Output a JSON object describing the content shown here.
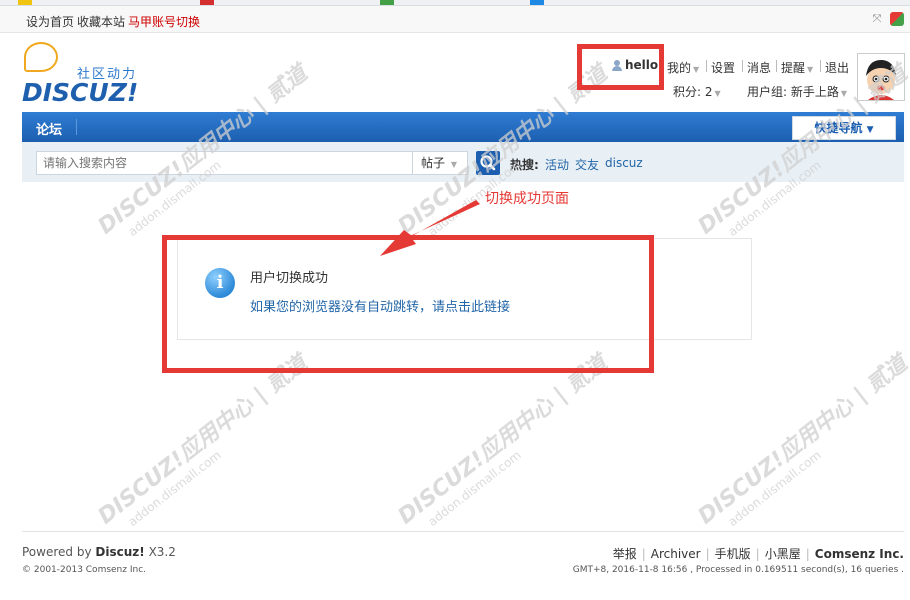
{
  "topbar": {
    "set_home": "设为首页",
    "bookmark": "收藏本站",
    "switch_account": "马甲账号切换"
  },
  "logo": {
    "slogan": "社区动力",
    "wordmark": "DISCUZ!"
  },
  "user": {
    "name": "hello",
    "menu_mine": "我的",
    "menu_settings": "设置",
    "menu_messages": "消息",
    "menu_reminders": "提醒",
    "menu_logout": "退出",
    "credits": "积分: 2",
    "group": "用户组: 新手上路"
  },
  "nav": {
    "forum": "论坛",
    "quick_nav": "快捷导航"
  },
  "search": {
    "placeholder": "请输入搜索内容",
    "type": "帖子",
    "hot_label": "热搜:",
    "hot_items": [
      "活动",
      "交友",
      "discuz"
    ]
  },
  "annotation": {
    "label": "切换成功页面"
  },
  "message": {
    "title": "用户切换成功",
    "link_text": "如果您的浏览器没有自动跳转，请点击此链接"
  },
  "watermark": {
    "brand": "DISCUZ!应用中心 | 贰道",
    "url": "addon.dismall.com"
  },
  "footer": {
    "powered_prefix": "Powered by",
    "powered_name": "Discuz!",
    "powered_version": "X3.2",
    "copyright": "© 2001-2013 Comsenz Inc.",
    "links": [
      "举报",
      "Archiver",
      "手机版",
      "小黑屋"
    ],
    "company": "Comsenz Inc.",
    "gmt": "GMT+8, 2016-11-8 16:56 , Processed in 0.169511 second(s), 16 queries ."
  },
  "colors": {
    "accent": "#1c5fb0",
    "link": "#2366a8",
    "annotation": "#e53935"
  }
}
